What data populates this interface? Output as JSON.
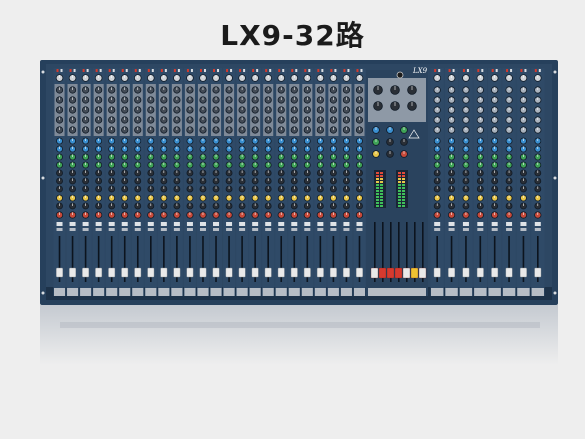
{
  "page": {
    "title": "LX9-32路"
  },
  "mixer": {
    "brand_logo": "LX9",
    "mono_channels": 24,
    "stereo_channels": 8,
    "colors": {
      "panel": "#2d4763",
      "panel_dark": "#1f344b",
      "strip_grey": "#7f8a98",
      "knob_blue": "#3a8fd0",
      "knob_green": "#3fa357",
      "knob_yellow": "#e8c64a",
      "knob_red": "#c84a3a",
      "fader_cap": "#e9e9e9",
      "fader_red": "#d63a2f",
      "fader_yellow": "#f0c232"
    }
  }
}
